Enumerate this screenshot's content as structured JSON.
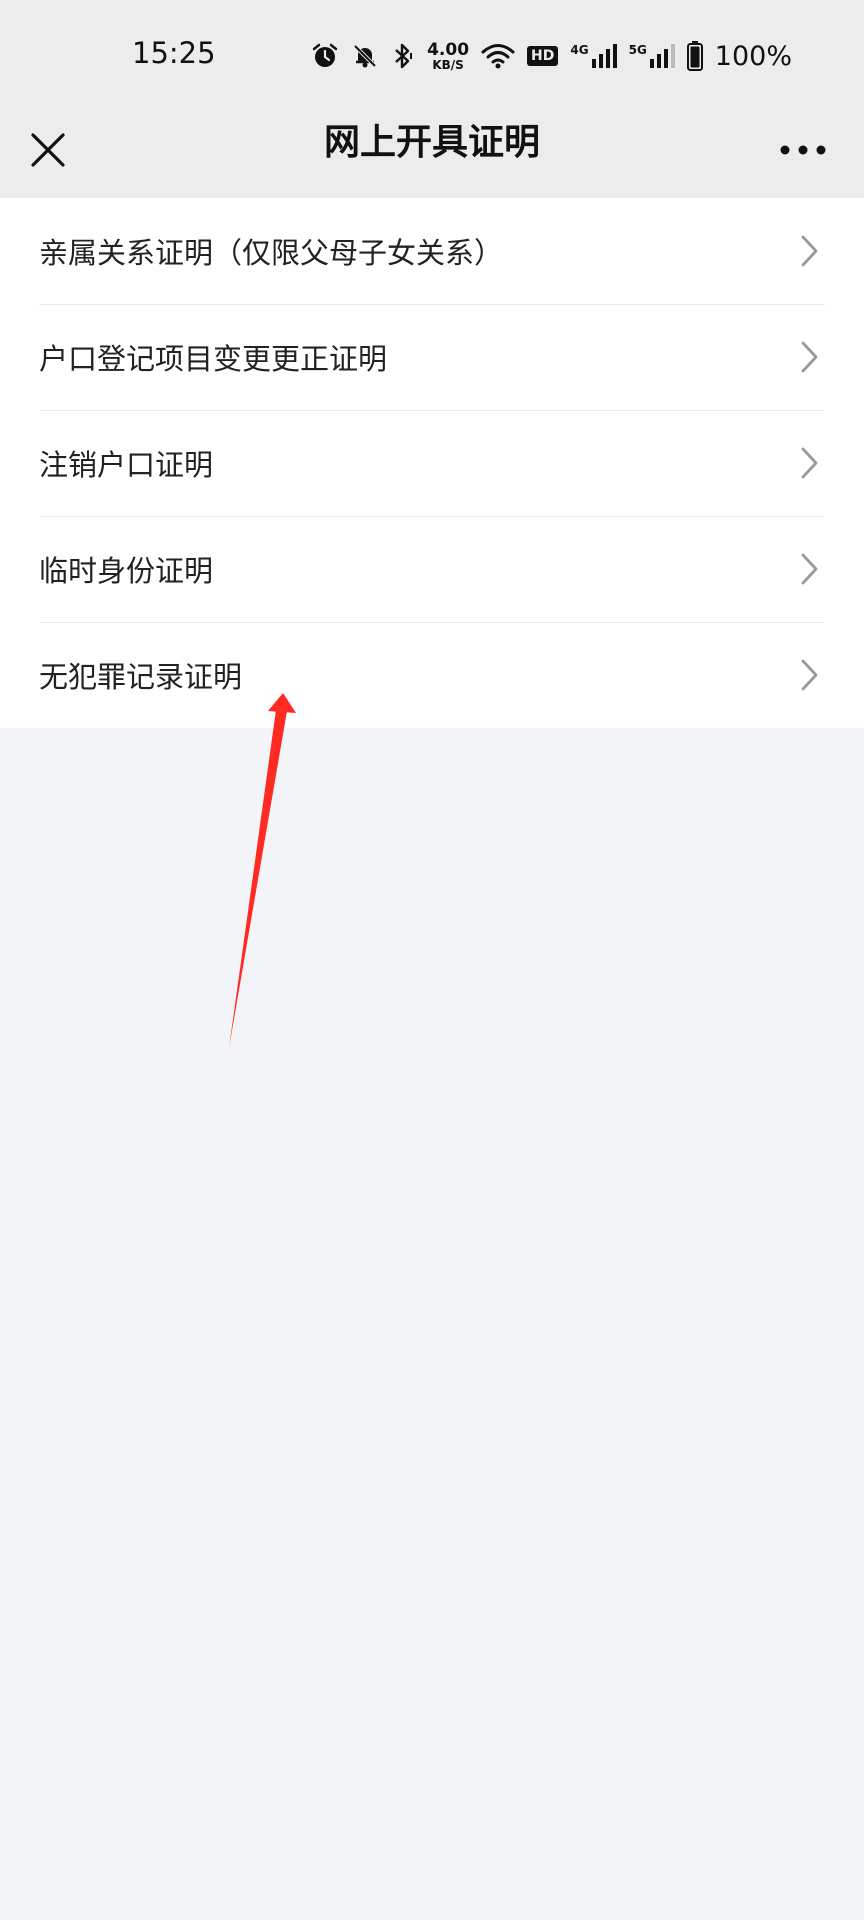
{
  "status_bar": {
    "time": "15:25",
    "net_speed_value": "4.00",
    "net_speed_unit": "KB/S",
    "hd_badge": "HD",
    "signal1_label": "4G",
    "signal2_label": "5G",
    "battery_percent": "100%",
    "icons": [
      "alarm-icon",
      "bell-off-icon",
      "bluetooth-icon",
      "wifi-icon",
      "signal-icon",
      "battery-icon"
    ]
  },
  "nav": {
    "title": "网上开具证明",
    "close_icon": "close-icon",
    "more_icon": "more-icon"
  },
  "list": {
    "items": [
      {
        "label": "亲属关系证明（仅限父母子女关系）"
      },
      {
        "label": "户口登记项目变更更正证明"
      },
      {
        "label": "注销户口证明"
      },
      {
        "label": "临时身份证明"
      },
      {
        "label": "无犯罪记录证明"
      }
    ]
  },
  "colors": {
    "nav_background": "#ececec",
    "page_background": "#f3f4f7",
    "list_background": "#ffffff",
    "annotation_arrow": "#ff2a22",
    "chevron": "#9a9a9a"
  }
}
